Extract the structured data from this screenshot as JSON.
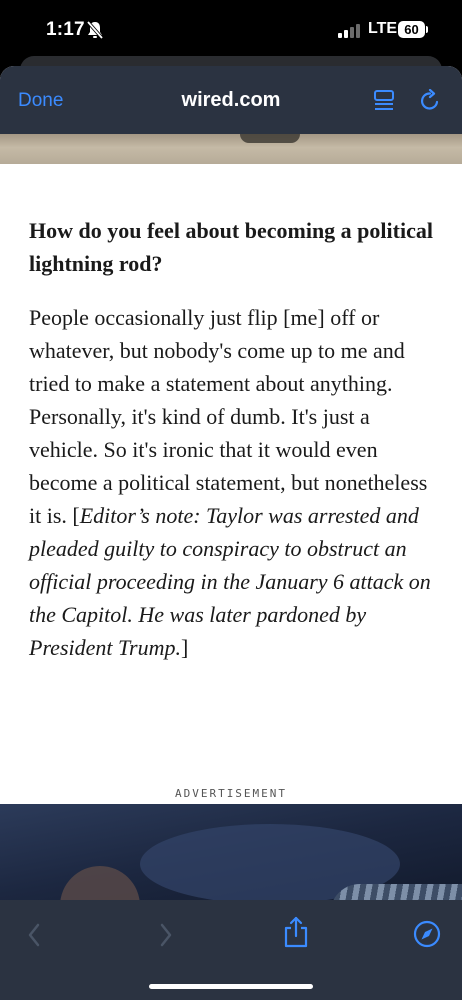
{
  "status_bar": {
    "time": "1:17",
    "network": "LTE",
    "battery": "60",
    "icons": [
      "bell-slash-icon",
      "signal-bars-icon",
      "battery-icon"
    ]
  },
  "browser": {
    "done_label": "Done",
    "site": "wired.com",
    "icons": [
      "reader-mode-icon",
      "reload-icon",
      "back-icon",
      "forward-icon",
      "share-icon",
      "compass-icon"
    ]
  },
  "article": {
    "question": "How do you feel about becoming a political lightning rod?",
    "answer": "People occasionally just flip [me] off or whatever, but nobody's come up to me and tried to make a statement about anything. Personally, it's kind of dumb. It's just a vehicle. So it's ironic that it would even become a political statement, but nonetheless it is. [",
    "editor_note": "Editor’s note: Taylor was arrested and pleaded guilty to conspiracy to obstruct an official proceeding in the January 6 attack on the Capitol. He was later pardoned by President Trump.",
    "closing": "]"
  },
  "advertisement": {
    "label": "ADVERTISEMENT"
  },
  "colors": {
    "toolbar_bg": "#2b3341",
    "accent_blue": "#3b8bff"
  }
}
